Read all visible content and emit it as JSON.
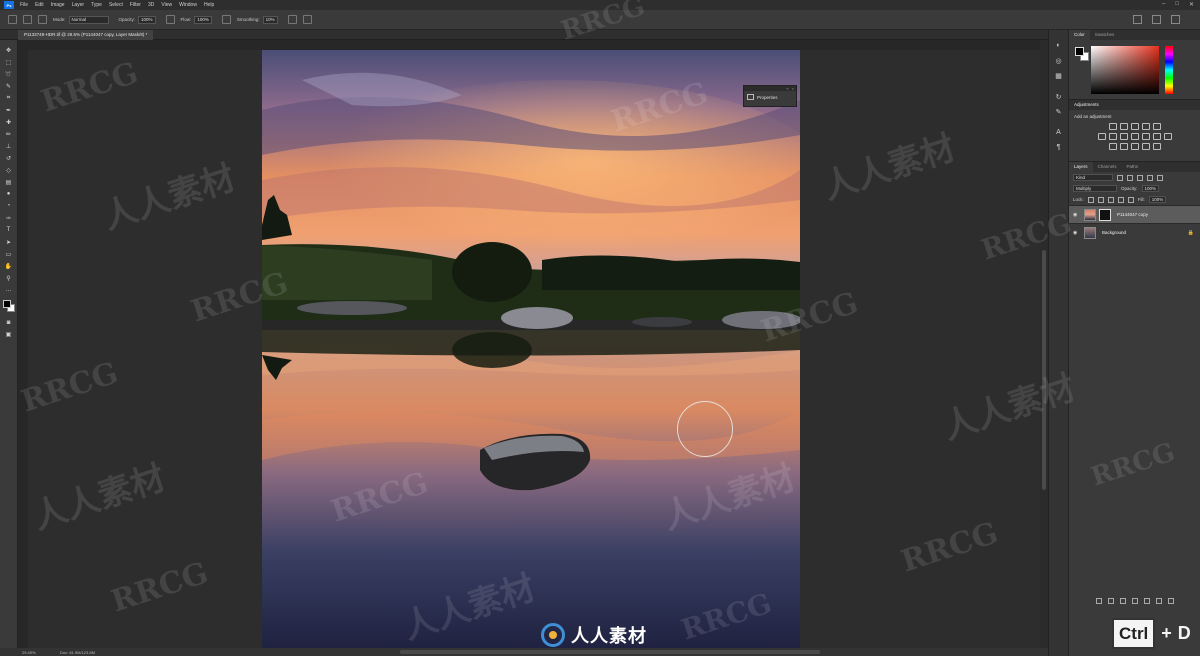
{
  "menu": [
    "File",
    "Edit",
    "Image",
    "Layer",
    "Type",
    "Select",
    "Filter",
    "3D",
    "View",
    "Window",
    "Help"
  ],
  "window_controls": [
    "–",
    "□",
    "✕"
  ],
  "options": {
    "mode_label": "Mode:",
    "mode_value": "Normal",
    "opacity_label": "Opacity:",
    "opacity_value": "100%",
    "flow_label": "Flow:",
    "flow_value": "100%",
    "smoothing_label": "Smoothing:",
    "smoothing_value": "10%"
  },
  "document_tab": "P1133749-HDR.tif @ 29.5% (P1144047 copy, Layer Mask/8) *",
  "properties_mini": {
    "label": "Properties"
  },
  "status": {
    "zoom": "29.49%",
    "doc_info": "Doc: 61.9M/123.8M"
  },
  "panels": {
    "color_tabs": [
      "Color",
      "Swatches"
    ],
    "adjustments_title": "Adjustments",
    "adjustments_hint": "Add an adjustment",
    "layers_tabs": [
      "Layers",
      "Channels",
      "Paths"
    ],
    "kind_label": "Kind",
    "blend_mode": "Multiply",
    "opacity_label": "Opacity:",
    "opacity_value": "100%",
    "lock_label": "Lock:",
    "fill_label": "Fill:",
    "fill_value": "100%",
    "layers": [
      {
        "name": "P1144047 copy",
        "selected": true
      },
      {
        "name": "Background",
        "selected": false
      }
    ]
  },
  "watermark": {
    "text_latin": "RRCG",
    "text_cn": "人人素材"
  },
  "logo_text": "人人素材",
  "shortcut": {
    "key1": "Ctrl",
    "plus": "+",
    "key2": "D"
  },
  "icons": {
    "toolbar": [
      "move-icon",
      "marquee-icon",
      "lasso-icon",
      "quick-select-icon",
      "crop-icon",
      "eyedropper-icon",
      "healing-icon",
      "brush-icon",
      "clone-stamp-icon",
      "history-brush-icon",
      "eraser-icon",
      "gradient-icon",
      "blur-icon",
      "dodge-icon",
      "pen-icon",
      "type-icon",
      "path-select-icon",
      "rectangle-icon",
      "hand-icon",
      "zoom-icon"
    ],
    "strip": [
      "color-panel-icon",
      "adjustments-panel-icon",
      "layers-panel-icon",
      "history-icon",
      "brush-settings-icon",
      "paragraph-icon",
      "character-icon"
    ]
  },
  "colors": {
    "accent": "#1473e6",
    "panel_bg": "#3a3a3a",
    "workspace_bg": "#272727",
    "picker_hue": "#e8321e"
  }
}
